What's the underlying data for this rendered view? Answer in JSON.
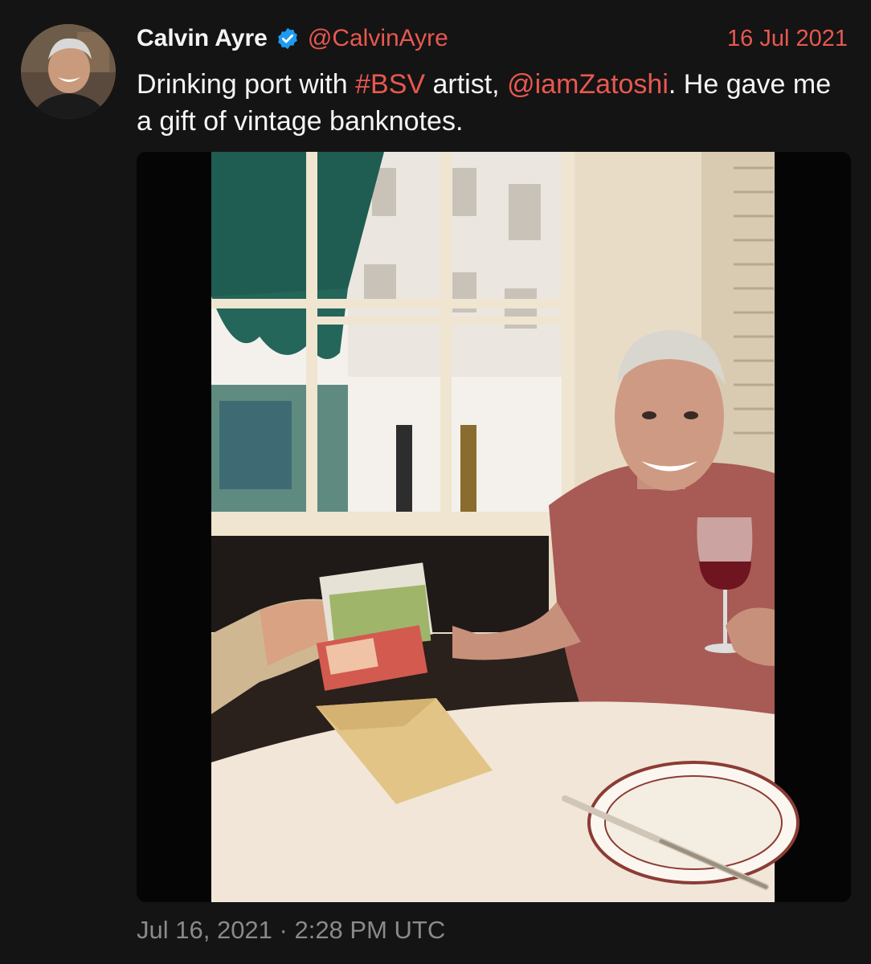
{
  "tweet": {
    "author": {
      "display_name": "Calvin Ayre",
      "handle": "@CalvinAyre",
      "verified": true,
      "avatar_icon": "profile-photo"
    },
    "date": "16 Jul 2021",
    "text_parts": [
      {
        "text": "Drinking port with ",
        "type": "text"
      },
      {
        "text": "#BSV",
        "type": "hashtag"
      },
      {
        "text": " artist, ",
        "type": "text"
      },
      {
        "text": "@iamZatoshi",
        "type": "mention"
      },
      {
        "text": ". He gave me a gift of vintage banknotes.",
        "type": "text"
      }
    ],
    "timestamp": "Jul 16, 2021 · 2:28 PM UTC"
  },
  "theme": {
    "background": "#141414",
    "accent": "#e8584f",
    "verified_color": "#1d9bf0",
    "muted": "#8a8a8a"
  }
}
